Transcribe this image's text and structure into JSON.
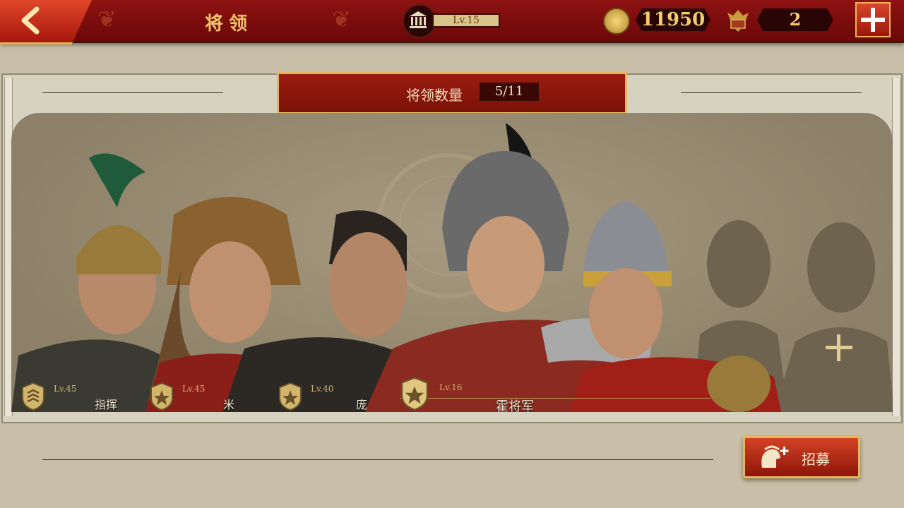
{
  "header": {
    "title": "将领",
    "level": "Lv.15",
    "coins": "11950",
    "premium": "2"
  },
  "panel": {
    "count_label": "将领数量",
    "count_value": "5/11"
  },
  "generals": [
    {
      "level": "Lv.45",
      "name": "指挥"
    },
    {
      "level": "Lv.45",
      "name": "米"
    },
    {
      "level": "Lv.40",
      "name": "庞"
    },
    {
      "level": "Lv.16",
      "name": "霍将军"
    }
  ],
  "actions": {
    "recruit_label": "招募"
  },
  "colors": {
    "header_red": "#7b0d0b",
    "gold": "#e3b44a",
    "panel": "#a79a80"
  },
  "icons": [
    "back-arrow-icon",
    "temple-icon",
    "coin-icon",
    "spqr-eagle-icon",
    "plus-icon",
    "rank-badge-icon",
    "spartan-helmet-icon"
  ]
}
